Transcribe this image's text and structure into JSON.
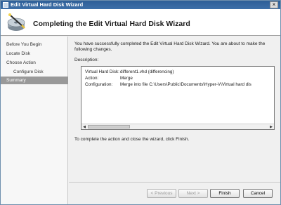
{
  "window": {
    "title": "Edit Virtual Hard Disk Wizard",
    "close_glyph": "×"
  },
  "header": {
    "heading": "Completing the Edit Virtual Hard Disk Wizard",
    "icon": "wizard-disk-icon"
  },
  "nav": {
    "items": [
      {
        "label": "Before You Begin"
      },
      {
        "label": "Locate Disk"
      },
      {
        "label": "Choose Action"
      },
      {
        "label": "Configure Disk"
      },
      {
        "label": "Summary"
      }
    ],
    "selected_index": 4
  },
  "main": {
    "intro": "You have successfully completed the Edit Virtual Hard Disk Wizard. You are about to make the following changes.",
    "description_label": "Description:",
    "summary": {
      "rows": [
        {
          "key": "Virtual Hard Disk:",
          "value": "different1.vhd (differencing)"
        },
        {
          "key": "Action:",
          "value": "Merge"
        },
        {
          "key": "Configuration:",
          "value": "Merge into file C:\\Users\\Public\\Documents\\Hyper-V\\Virtual hard dis"
        }
      ]
    },
    "finish_instruction": "To complete the action and close the wizard, click Finish."
  },
  "footer": {
    "previous_label": "< Previous",
    "next_label": "Next >",
    "finish_label": "Finish",
    "cancel_label": "Cancel"
  }
}
